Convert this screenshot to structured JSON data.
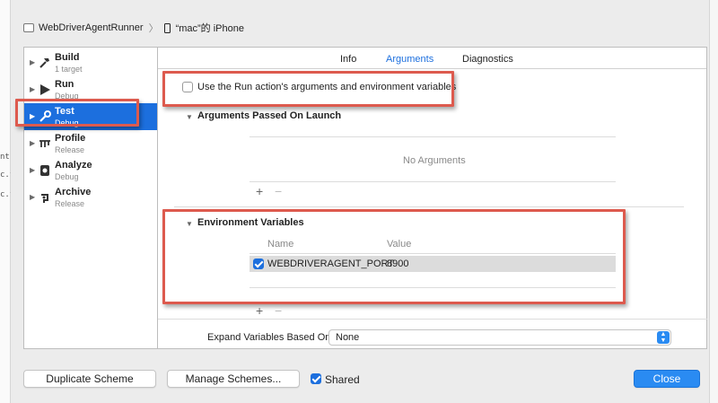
{
  "breadcrumb": {
    "scheme": "WebDriverAgentRunner",
    "device": "“mac”的 iPhone"
  },
  "sidebar": {
    "items": [
      {
        "label": "Build",
        "sub": "1 target",
        "icon": "hammer-icon"
      },
      {
        "label": "Run",
        "sub": "Debug",
        "icon": "play-icon"
      },
      {
        "label": "Test",
        "sub": "Debug",
        "icon": "wrench-icon",
        "selected": true
      },
      {
        "label": "Profile",
        "sub": "Release",
        "icon": "profile-icon"
      },
      {
        "label": "Analyze",
        "sub": "Debug",
        "icon": "analyze-icon"
      },
      {
        "label": "Archive",
        "sub": "Release",
        "icon": "archive-icon"
      }
    ]
  },
  "tabs": [
    {
      "label": "Info",
      "active": false
    },
    {
      "label": "Arguments",
      "active": true
    },
    {
      "label": "Diagnostics",
      "active": false
    }
  ],
  "use_run": {
    "label": "Use the Run action's arguments and environment variables",
    "checked": false
  },
  "arguments": {
    "title": "Arguments Passed On Launch",
    "empty_text": "No Arguments",
    "add": "+",
    "remove": "−"
  },
  "environment": {
    "title": "Environment Variables",
    "col_name": "Name",
    "col_value": "Value",
    "rows": [
      {
        "checked": true,
        "name": "WEBDRIVERAGENT_PORT",
        "value": "8900"
      }
    ],
    "add": "+",
    "remove": "−"
  },
  "expand": {
    "label": "Expand Variables Based On",
    "value": "None"
  },
  "footer": {
    "duplicate": "Duplicate Scheme",
    "manage": "Manage Schemes...",
    "shared_label": "Shared",
    "shared_checked": true,
    "close": "Close"
  },
  "colors": {
    "accent": "#1c6fde",
    "highlight_box": "#dd5a4e"
  }
}
